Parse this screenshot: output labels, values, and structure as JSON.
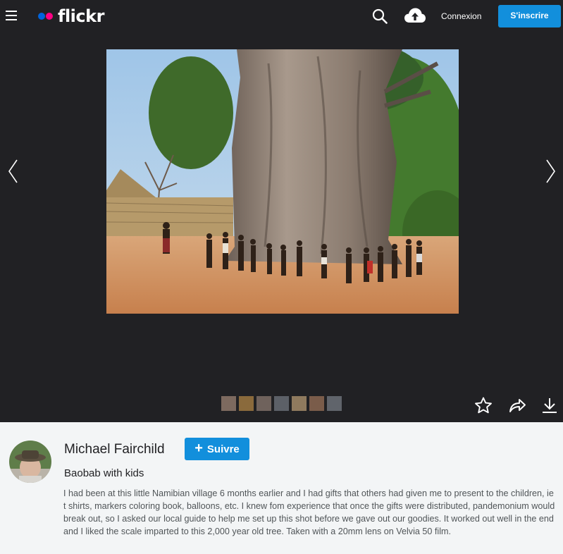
{
  "header": {
    "logo_text": "flickr",
    "login_label": "Connexion",
    "signup_label": "S'inscrire"
  },
  "icons": {
    "menu": "hamburger-icon",
    "search": "search-icon",
    "upload": "cloud-upload-icon",
    "prev": "chevron-left-icon",
    "next": "chevron-right-icon",
    "favorite": "star-icon",
    "share": "share-icon",
    "download": "download-icon",
    "follow": "plus-icon"
  },
  "colors": {
    "topbar_bg": "#212124",
    "accent_blue": "#128fdc",
    "logo_blue": "#0063dc",
    "logo_pink": "#ff0084"
  },
  "viewer": {
    "thumbnail_count": 7
  },
  "photo_info": {
    "author": "Michael Fairchild",
    "follow_label": "Suivre",
    "title": "Baobab with kids",
    "description": "I had been at this little Namibian village 6 months earlier and I had gifts that others had given me to present to the children, ie t shirts, markers coloring book, balloons, etc. I knew fom experience that once the gifts were distributed, pandemonium would break out, so I asked our local guide to help me set up this shot before we gave out our goodies. It worked out well in the end and I liked the scale imparted to this 2,000 year old tree. Taken with a 20mm lens on Velvia 50 film."
  }
}
